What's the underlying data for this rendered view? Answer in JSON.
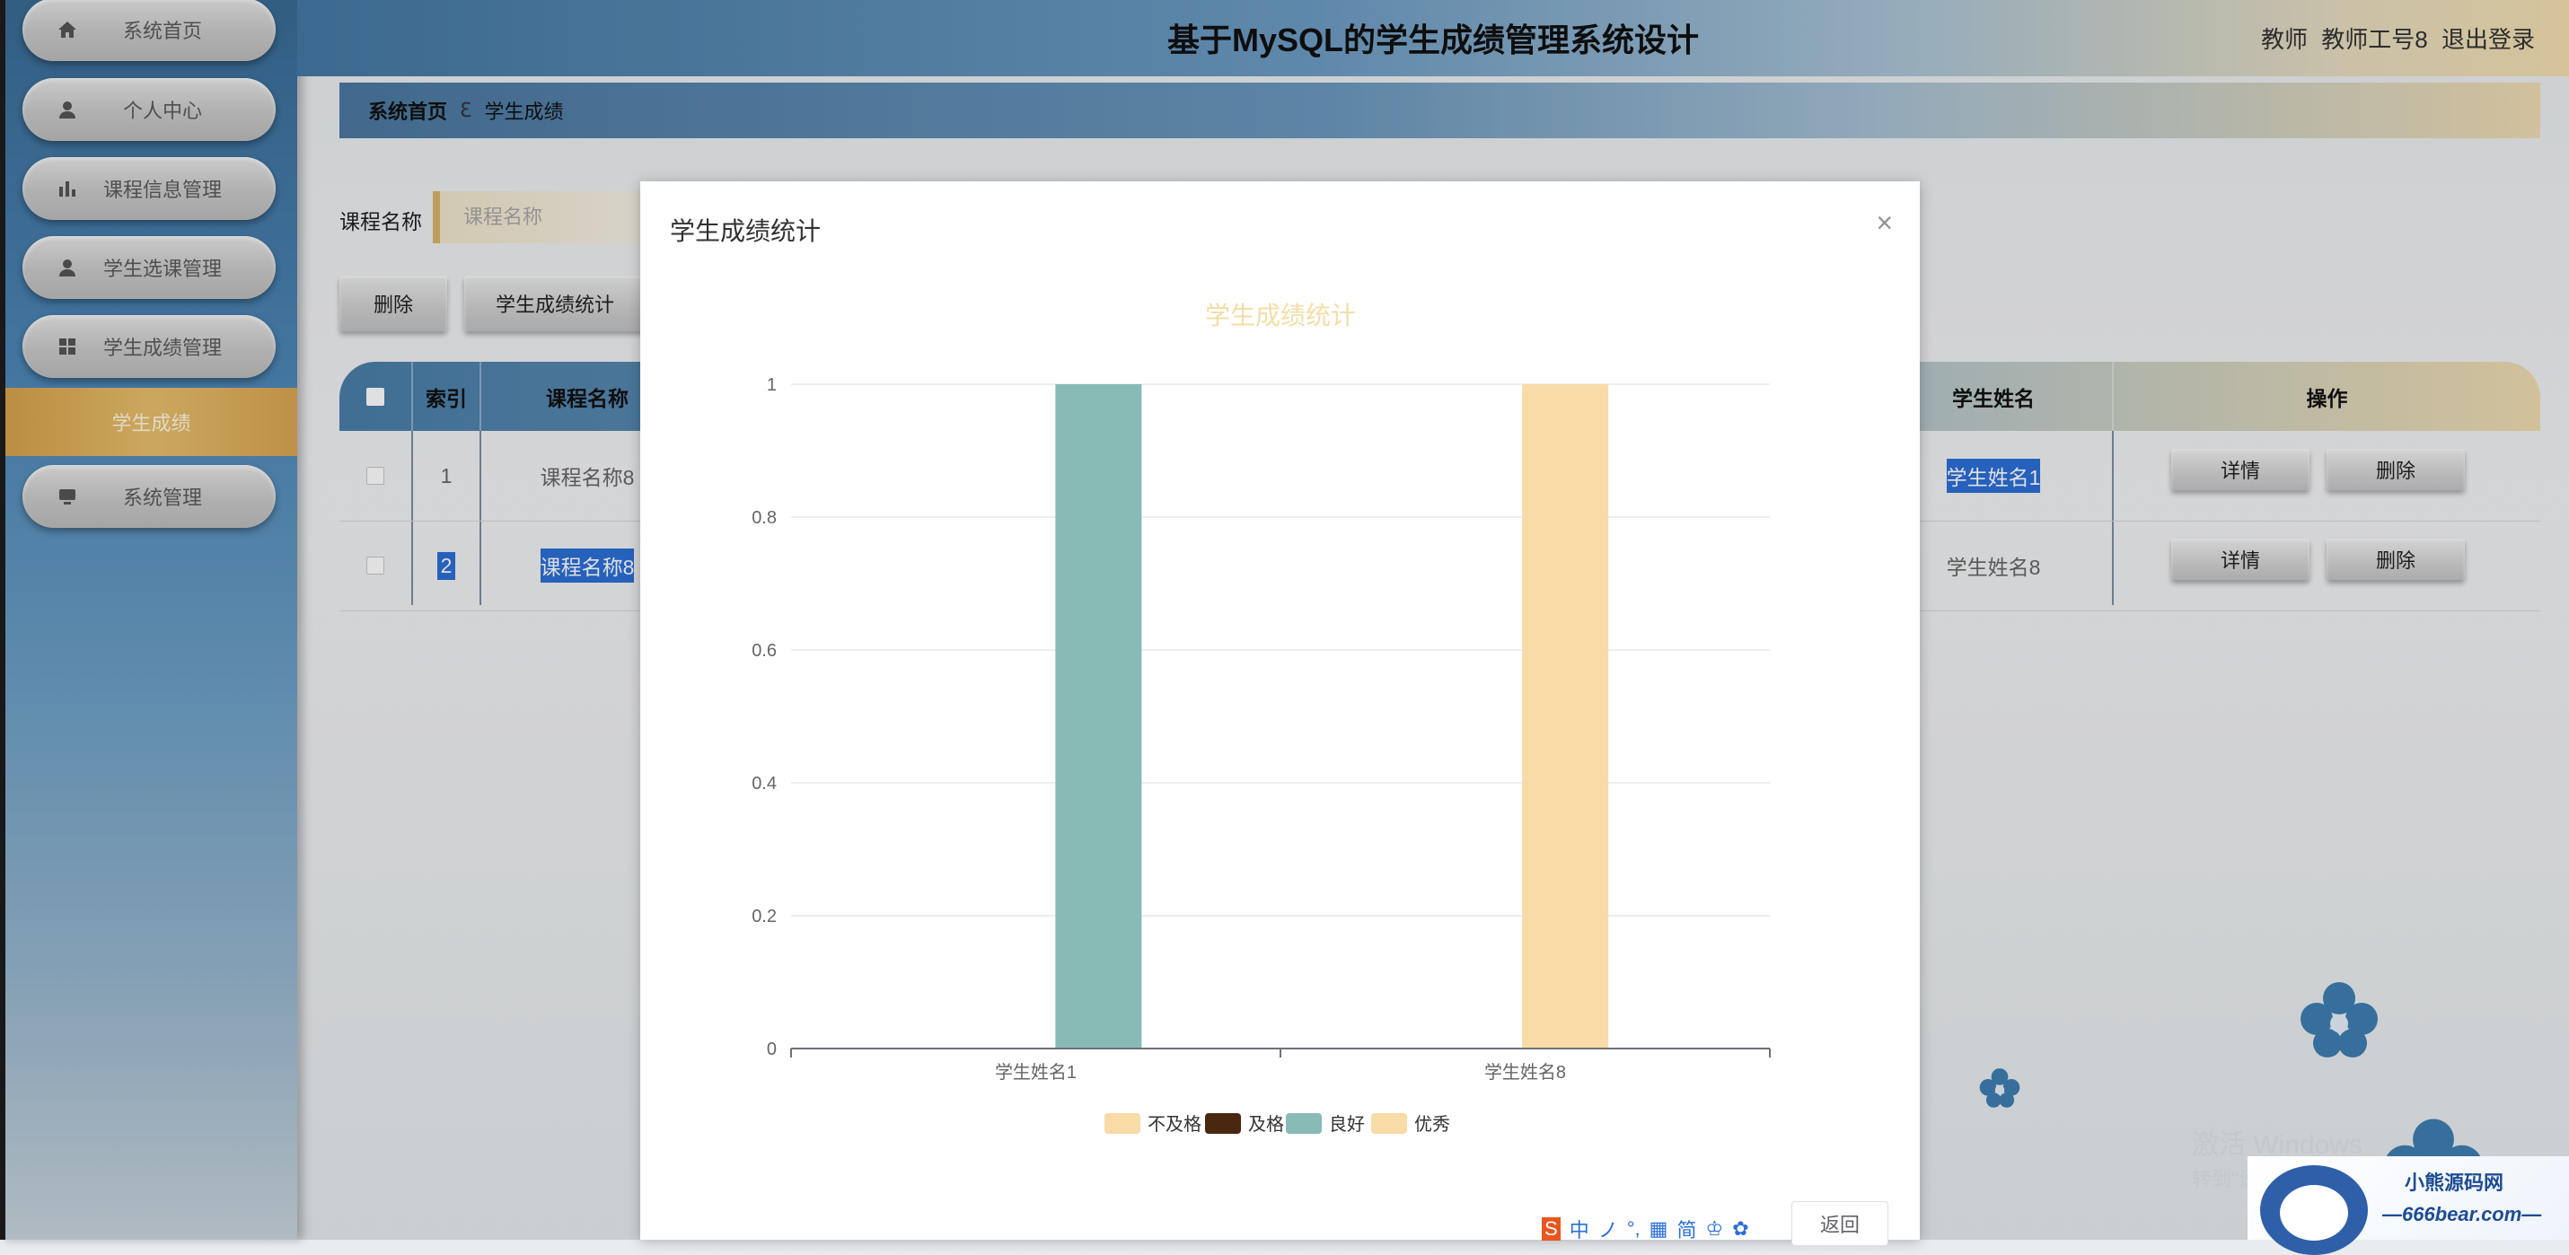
{
  "app": {
    "title": "基于MySQL的学生成绩管理系统设计",
    "user_role": "教师",
    "user_name": "教师工号8",
    "logout": "退出登录"
  },
  "sidebar": {
    "items": [
      {
        "label": "系统首页",
        "icon": "home-icon"
      },
      {
        "label": "个人中心",
        "icon": "user-icon"
      },
      {
        "label": "课程信息管理",
        "icon": "bar-chart-icon"
      },
      {
        "label": "学生选课管理",
        "icon": "user-icon"
      },
      {
        "label": "学生成绩管理",
        "icon": "grid-icon"
      },
      {
        "label": "系统管理",
        "icon": "monitor-icon"
      }
    ],
    "active_sub": "学生成绩"
  },
  "breadcrumb": {
    "home": "系统首页",
    "sep": "ℇ",
    "current": "学生成绩"
  },
  "search": {
    "label": "课程名称",
    "placeholder": "课程名称"
  },
  "actions": {
    "delete": "删除",
    "stats": "学生成绩统计"
  },
  "table": {
    "headers": {
      "index": "索引",
      "course": "课程名称",
      "student": "学生姓名",
      "ops": "操作"
    },
    "rows": [
      {
        "index": "1",
        "course": "课程名称8",
        "student": "学生姓名1"
      },
      {
        "index": "2",
        "course": "课程名称8",
        "student": "学生姓名8"
      }
    ],
    "detail": "详情",
    "delete": "删除"
  },
  "modal": {
    "title": "学生成绩统计",
    "close": "×",
    "cancel": "返回"
  },
  "chart_data": {
    "type": "bar",
    "title": "学生成绩统计",
    "categories": [
      "学生姓名1",
      "学生姓名8"
    ],
    "series": [
      {
        "name": "不及格",
        "color": "#f8dba7",
        "values": [
          0,
          0
        ]
      },
      {
        "name": "及格",
        "color": "#4a2810",
        "values": [
          0,
          0
        ]
      },
      {
        "name": "良好",
        "color": "#88bab6",
        "values": [
          1,
          0
        ]
      },
      {
        "name": "优秀",
        "color": "#f8dba7",
        "values": [
          0,
          1
        ]
      }
    ],
    "ylim": [
      0,
      1
    ],
    "yticks": [
      "0",
      "0.2",
      "0.4",
      "0.6",
      "0.8",
      "1"
    ],
    "legend_position": "bottom",
    "grid": true
  },
  "desktop": {
    "watermark_line1": "激活 Windows",
    "watermark_line2": "转到\"设置\"以激活 Windows。",
    "brand_name": "小熊源码网",
    "brand_url": "—666bear.com—",
    "ime_items": [
      "中",
      "ノ",
      "°,",
      "▦",
      "简",
      "♔",
      "✿"
    ]
  }
}
